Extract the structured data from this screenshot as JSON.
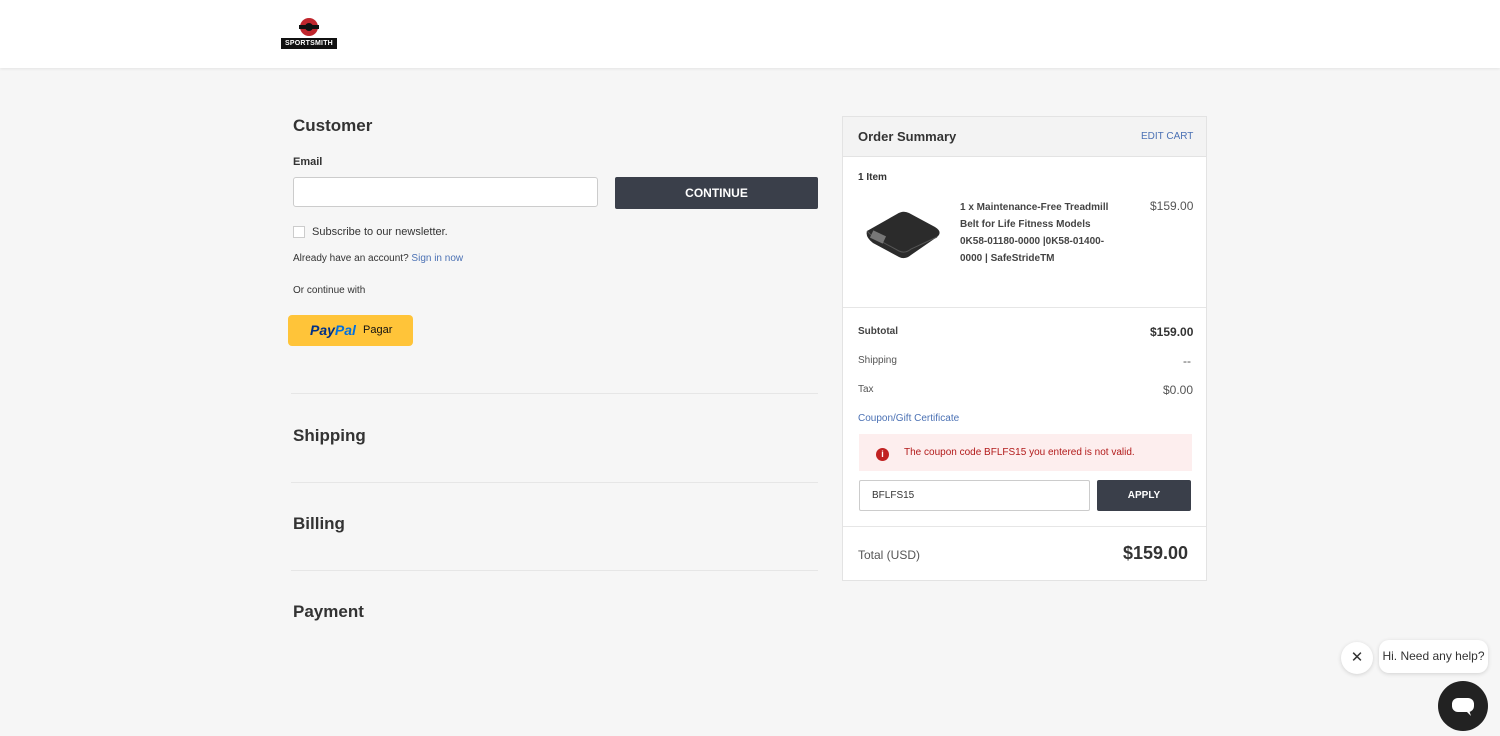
{
  "brand": {
    "logo_text": "SPORTSMITH"
  },
  "customer": {
    "title": "Customer",
    "email_label": "Email",
    "email_value": "",
    "continue_label": "CONTINUE",
    "newsletter_label": "Subscribe to our newsletter.",
    "account_prompt": "Already have an account?",
    "signin_label": "Sign in now",
    "or_continue": "Or continue with",
    "paypal": {
      "pay": "Pay",
      "pal": "Pal",
      "label": "Pagar"
    }
  },
  "sections": {
    "shipping": "Shipping",
    "billing": "Billing",
    "payment": "Payment"
  },
  "summary": {
    "title": "Order Summary",
    "edit_cart": "EDIT CART",
    "item_count": "1 Item",
    "item": {
      "name": "1 x Maintenance-Free Treadmill Belt for Life Fitness Models 0K58-01180-0000 |0K58-01400-0000 | SafeStrideTM",
      "price": "$159.00"
    },
    "subtotal_label": "Subtotal",
    "subtotal_value": "$159.00",
    "shipping_label": "Shipping",
    "shipping_value": "--",
    "tax_label": "Tax",
    "tax_value": "$0.00",
    "coupon_link": "Coupon/Gift Certificate",
    "error_message": "The coupon code BFLFS15 you entered is not valid.",
    "coupon_value": "BFLFS15",
    "apply_label": "APPLY",
    "total_label": "Total (USD)",
    "total_value": "$159.00"
  },
  "chat": {
    "greeting": "Hi. Need any help?"
  },
  "colors": {
    "accent_dark": "#3a3f4a",
    "link": "#4b71b4",
    "error": "#c12222",
    "paypal": "#ffc439"
  }
}
